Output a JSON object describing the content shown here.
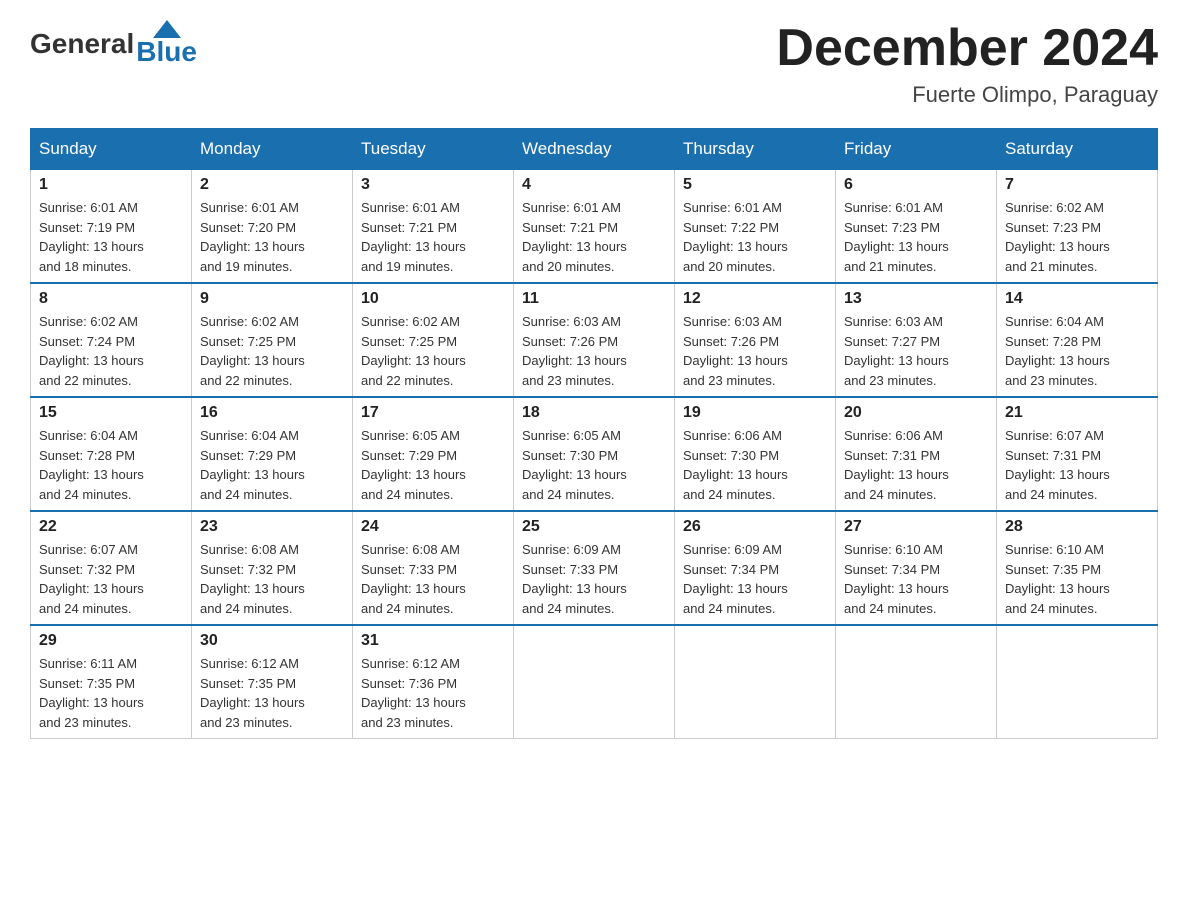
{
  "logo": {
    "general": "General",
    "blue": "Blue"
  },
  "title": {
    "month_year": "December 2024",
    "location": "Fuerte Olimpo, Paraguay"
  },
  "headers": [
    "Sunday",
    "Monday",
    "Tuesday",
    "Wednesday",
    "Thursday",
    "Friday",
    "Saturday"
  ],
  "weeks": [
    [
      {
        "day": "1",
        "sunrise": "6:01 AM",
        "sunset": "7:19 PM",
        "daylight": "13 hours and 18 minutes."
      },
      {
        "day": "2",
        "sunrise": "6:01 AM",
        "sunset": "7:20 PM",
        "daylight": "13 hours and 19 minutes."
      },
      {
        "day": "3",
        "sunrise": "6:01 AM",
        "sunset": "7:21 PM",
        "daylight": "13 hours and 19 minutes."
      },
      {
        "day": "4",
        "sunrise": "6:01 AM",
        "sunset": "7:21 PM",
        "daylight": "13 hours and 20 minutes."
      },
      {
        "day": "5",
        "sunrise": "6:01 AM",
        "sunset": "7:22 PM",
        "daylight": "13 hours and 20 minutes."
      },
      {
        "day": "6",
        "sunrise": "6:01 AM",
        "sunset": "7:23 PM",
        "daylight": "13 hours and 21 minutes."
      },
      {
        "day": "7",
        "sunrise": "6:02 AM",
        "sunset": "7:23 PM",
        "daylight": "13 hours and 21 minutes."
      }
    ],
    [
      {
        "day": "8",
        "sunrise": "6:02 AM",
        "sunset": "7:24 PM",
        "daylight": "13 hours and 22 minutes."
      },
      {
        "day": "9",
        "sunrise": "6:02 AM",
        "sunset": "7:25 PM",
        "daylight": "13 hours and 22 minutes."
      },
      {
        "day": "10",
        "sunrise": "6:02 AM",
        "sunset": "7:25 PM",
        "daylight": "13 hours and 22 minutes."
      },
      {
        "day": "11",
        "sunrise": "6:03 AM",
        "sunset": "7:26 PM",
        "daylight": "13 hours and 23 minutes."
      },
      {
        "day": "12",
        "sunrise": "6:03 AM",
        "sunset": "7:26 PM",
        "daylight": "13 hours and 23 minutes."
      },
      {
        "day": "13",
        "sunrise": "6:03 AM",
        "sunset": "7:27 PM",
        "daylight": "13 hours and 23 minutes."
      },
      {
        "day": "14",
        "sunrise": "6:04 AM",
        "sunset": "7:28 PM",
        "daylight": "13 hours and 23 minutes."
      }
    ],
    [
      {
        "day": "15",
        "sunrise": "6:04 AM",
        "sunset": "7:28 PM",
        "daylight": "13 hours and 24 minutes."
      },
      {
        "day": "16",
        "sunrise": "6:04 AM",
        "sunset": "7:29 PM",
        "daylight": "13 hours and 24 minutes."
      },
      {
        "day": "17",
        "sunrise": "6:05 AM",
        "sunset": "7:29 PM",
        "daylight": "13 hours and 24 minutes."
      },
      {
        "day": "18",
        "sunrise": "6:05 AM",
        "sunset": "7:30 PM",
        "daylight": "13 hours and 24 minutes."
      },
      {
        "day": "19",
        "sunrise": "6:06 AM",
        "sunset": "7:30 PM",
        "daylight": "13 hours and 24 minutes."
      },
      {
        "day": "20",
        "sunrise": "6:06 AM",
        "sunset": "7:31 PM",
        "daylight": "13 hours and 24 minutes."
      },
      {
        "day": "21",
        "sunrise": "6:07 AM",
        "sunset": "7:31 PM",
        "daylight": "13 hours and 24 minutes."
      }
    ],
    [
      {
        "day": "22",
        "sunrise": "6:07 AM",
        "sunset": "7:32 PM",
        "daylight": "13 hours and 24 minutes."
      },
      {
        "day": "23",
        "sunrise": "6:08 AM",
        "sunset": "7:32 PM",
        "daylight": "13 hours and 24 minutes."
      },
      {
        "day": "24",
        "sunrise": "6:08 AM",
        "sunset": "7:33 PM",
        "daylight": "13 hours and 24 minutes."
      },
      {
        "day": "25",
        "sunrise": "6:09 AM",
        "sunset": "7:33 PM",
        "daylight": "13 hours and 24 minutes."
      },
      {
        "day": "26",
        "sunrise": "6:09 AM",
        "sunset": "7:34 PM",
        "daylight": "13 hours and 24 minutes."
      },
      {
        "day": "27",
        "sunrise": "6:10 AM",
        "sunset": "7:34 PM",
        "daylight": "13 hours and 24 minutes."
      },
      {
        "day": "28",
        "sunrise": "6:10 AM",
        "sunset": "7:35 PM",
        "daylight": "13 hours and 24 minutes."
      }
    ],
    [
      {
        "day": "29",
        "sunrise": "6:11 AM",
        "sunset": "7:35 PM",
        "daylight": "13 hours and 23 minutes."
      },
      {
        "day": "30",
        "sunrise": "6:12 AM",
        "sunset": "7:35 PM",
        "daylight": "13 hours and 23 minutes."
      },
      {
        "day": "31",
        "sunrise": "6:12 AM",
        "sunset": "7:36 PM",
        "daylight": "13 hours and 23 minutes."
      },
      null,
      null,
      null,
      null
    ]
  ],
  "labels": {
    "sunrise": "Sunrise:",
    "sunset": "Sunset:",
    "daylight": "Daylight:"
  }
}
